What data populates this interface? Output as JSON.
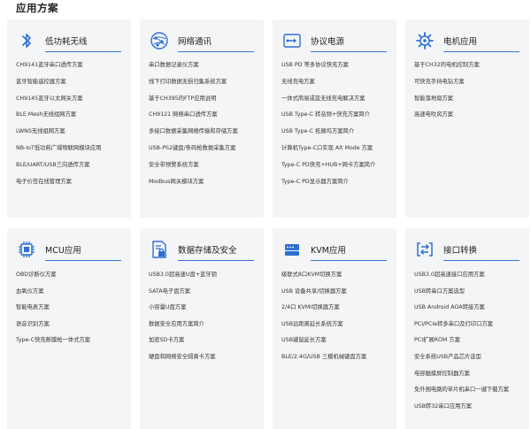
{
  "page": {
    "title": "应用方案"
  },
  "cards": [
    {
      "title": "低功耗无线",
      "icon": "bluetooth-icon",
      "items": [
        "CH9141蓝牙串口透传方案",
        "蓝牙智能遥控器方案",
        "CH9145蓝牙以太网关方案",
        "BLE Mesh无线组网方案",
        "LWNS无线组网方案",
        "NB-IoT低功耗广域物联网模块应用",
        "BLE/UART/USB三向透传方案",
        "电子价签在线管理方案"
      ]
    },
    {
      "title": "网络通讯",
      "icon": "network-globe-icon",
      "items": [
        "串口数据记录仪方案",
        "线下打印数据无损归集系统方案",
        "基于CH395的FTP应用说明",
        "CH9121 网络串口透传方案",
        "多接口数据采集网络传输和存储方案",
        "USB-PS2键盘/条码枪数据采集方案",
        "安全带预警系统方案",
        "Modbus网关模块方案"
      ]
    },
    {
      "title": "协议电源",
      "icon": "usb-power-icon",
      "items": [
        "USB PD 等多协议快充方案",
        "无线充电方案",
        "一体式简易或蓝无线充电解决方案",
        "USB Type-C 转音频+快充方案简介",
        "USB Type-C 拓展坞方案简介",
        "计算机Type-C口实现 Alt Mode 方案",
        "Type-C PD快充+HUB+网卡方案简介",
        "Type-C PD显示器方案简介"
      ]
    },
    {
      "title": "电机应用",
      "icon": "motor-gear-icon",
      "items": [
        "基于CH32的电机控制方案",
        "可快充手持电钻方案",
        "智能落地扇方案",
        "高速电吹风方案"
      ]
    },
    {
      "title": "MCU应用",
      "icon": "chip-icon",
      "items": [
        "OBD诊断仪方案",
        "血氧仪方案",
        "智能电表方案",
        "语音识别方案",
        "Type-C快充断膜枪一体式方案"
      ]
    },
    {
      "title": "数据存储及安全",
      "icon": "secure-storage-icon",
      "items": [
        "USB3.0超高速U盘+蓝牙钥",
        "SATA电子盘方案",
        "小容量U盘方案",
        "数据安全应用方案简介",
        "加密SD卡方案",
        "硬盘和网络安全隔离卡方案"
      ]
    },
    {
      "title": "KVM应用",
      "icon": "kvm-switch-icon",
      "items": [
        "级联式8口KVM切换方案",
        "USB 设备共享/切换器方案",
        "2/4口 KVMI切换器方案",
        "USB远距离延长系统方案",
        "USB键鼠延长方案",
        "BLE/2.4G/USB 三模机械键盘方案"
      ]
    },
    {
      "title": "接口转换",
      "icon": "interface-convert-icon",
      "items": [
        "USB3.0超高速接口应用方案",
        "USB转串口方案选型",
        "USB Android AOA转接方案",
        "PCI/PCIe转多串口及打印口方案",
        "PCI扩展ROM 方案",
        "安全系统USB产品芯片选型",
        "电容触摸屏控制器方案",
        "免外围电路的单片机串口一键下载方案",
        "USB转32串口应用方案"
      ]
    }
  ]
}
